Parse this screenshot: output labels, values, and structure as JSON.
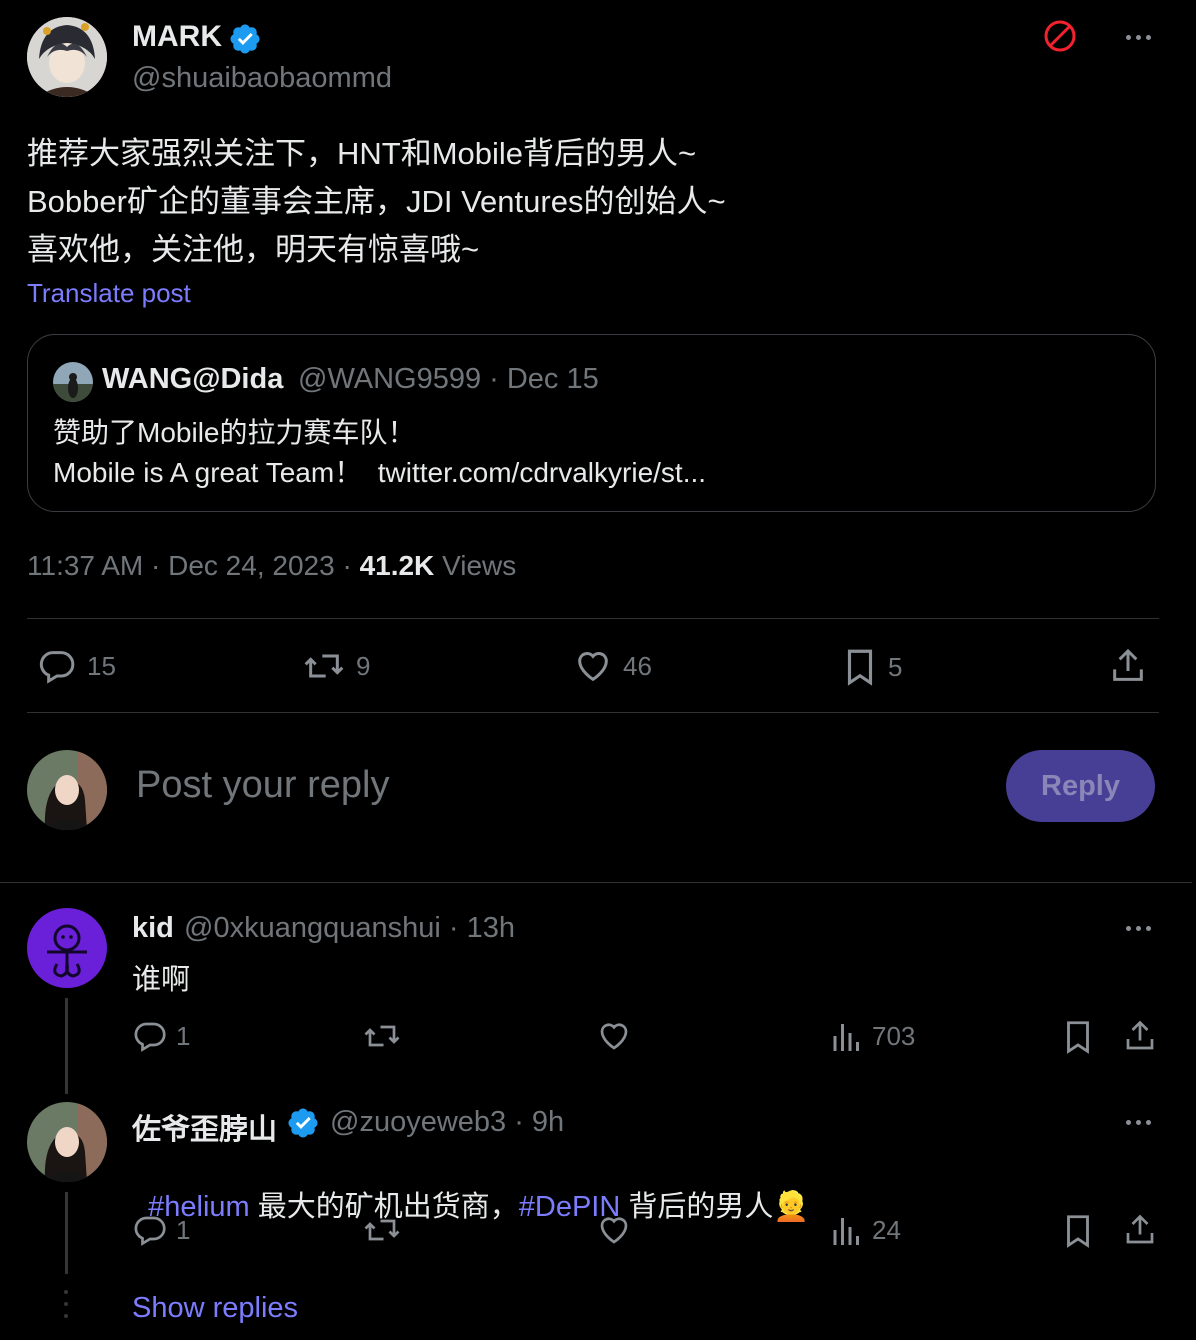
{
  "post": {
    "author_name": "MARK",
    "author_handle": "@shuaibaobaommd",
    "text_lines": [
      "推荐大家强烈关注下，HNT和Mobile背后的男人~",
      "Bobber矿企的董事会主席，JDI Ventures的创始人~",
      "喜欢他，关注他，明天有惊喜哦~"
    ],
    "translate": "Translate post",
    "timestamp": "11:37 AM · Dec 24, 2023 · ",
    "views_count": "41.2K",
    "views_label": "Views",
    "stats": {
      "replies": "15",
      "reposts": "9",
      "likes": "46",
      "bookmarks": "5"
    }
  },
  "quote": {
    "name": "WANG@Dida",
    "handle_date": "@WANG9599 · Dec 15",
    "line1": "赞助了Mobile的拉力赛车队！",
    "line2": "Mobile is A great Team！  twitter.com/cdrvalkyrie/st..."
  },
  "composer": {
    "placeholder": "Post your reply",
    "button": "Reply"
  },
  "replies": [
    {
      "name": "kid",
      "handle_time": "@0xkuangquanshui · 13h",
      "text": "谁啊",
      "replies": "1",
      "views": "703"
    },
    {
      "name": "佐爷歪脖山",
      "handle_time": "@zuoyeweb3 · 9h",
      "hashtag1": "#helium",
      "text_mid": " 最大的矿机出货商，",
      "hashtag2": "#DePIN",
      "text_end": " 背后的男人",
      "emoji": "👱",
      "replies": "1",
      "views": "24"
    }
  ],
  "show_replies": "Show replies",
  "colors": {
    "accent": "#7c7cff",
    "reply_button": "#473f96",
    "verified": "#1d9bf0",
    "block": "#f4212e"
  }
}
